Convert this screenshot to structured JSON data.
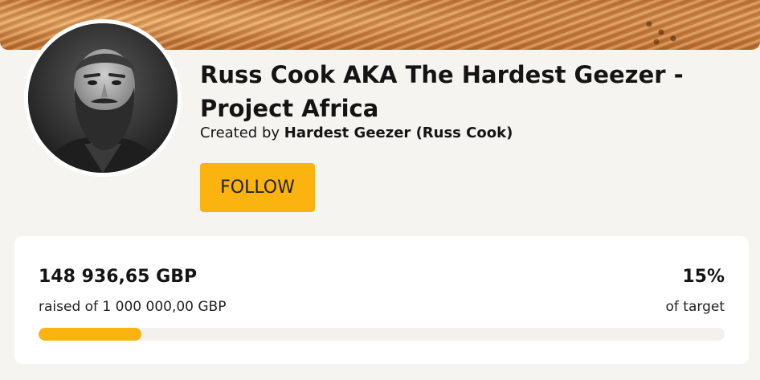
{
  "campaign": {
    "title": "Russ Cook AKA The Hardest Geezer - Project Africa",
    "created_by_prefix": "Created by",
    "creator_name": "Hardest Geezer (Russ Cook)",
    "follow_label": "FOLLOW"
  },
  "fundraising": {
    "raised_amount": "148 936,65 GBP",
    "raised_of_text": "raised of 1 000 000,00 GBP",
    "percent_label": "15%",
    "of_target_label": "of target",
    "progress_fraction": 0.15
  },
  "icons": {
    "avatar": "bearded-man-portrait"
  },
  "colors": {
    "accent": "#fbb40f",
    "background": "#f5f4f0",
    "card": "#ffffff",
    "text": "#141414"
  }
}
